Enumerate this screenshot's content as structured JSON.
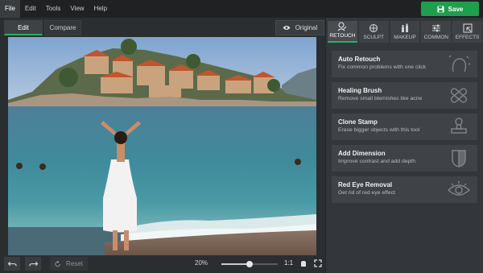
{
  "menu": {
    "items": [
      "File",
      "Edit",
      "Tools",
      "View",
      "Help"
    ]
  },
  "save": {
    "label": "Save"
  },
  "mode_tabs": {
    "edit": "Edit",
    "compare": "Compare"
  },
  "original": {
    "label": "Original"
  },
  "categories": [
    {
      "label": "RETOUCH",
      "icon": "retouch-icon"
    },
    {
      "label": "SCULPT",
      "icon": "sculpt-icon"
    },
    {
      "label": "MAKEUP",
      "icon": "makeup-icon"
    },
    {
      "label": "COMMON",
      "icon": "sliders-icon"
    },
    {
      "label": "EFFECTS",
      "icon": "effects-icon"
    }
  ],
  "tools": [
    {
      "title": "Auto Retouch",
      "desc": "Fix common problems with one click",
      "icon": "magic-face-icon"
    },
    {
      "title": "Healing Brush",
      "desc": "Remove small blemishes like acne",
      "icon": "bandage-icon"
    },
    {
      "title": "Clone Stamp",
      "desc": "Erase bigger objects with this tool",
      "icon": "stamp-icon"
    },
    {
      "title": "Add Dimension",
      "desc": "Improve contrast and add depth",
      "icon": "dimension-face-icon"
    },
    {
      "title": "Red Eye Removal",
      "desc": "Get rid of red eye effect",
      "icon": "eye-icon"
    }
  ],
  "bottom": {
    "reset_label": "Reset",
    "zoom_percent": "20%",
    "zoom_level": 0.5,
    "one_to_one": "1:1"
  },
  "colors": {
    "accent": "#24b35f",
    "save": "#1f9e4e"
  }
}
